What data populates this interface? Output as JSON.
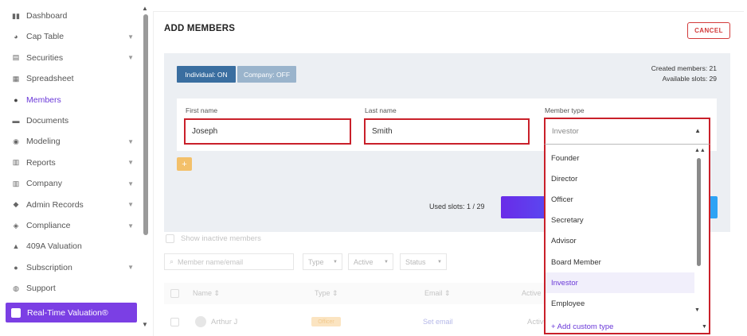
{
  "sidebar": {
    "items": [
      {
        "label": "Dashboard",
        "icon": "dashboard-icon",
        "chevron": false
      },
      {
        "label": "Cap Table",
        "icon": "pie-chart-icon",
        "chevron": true
      },
      {
        "label": "Securities",
        "icon": "clipboard-icon",
        "chevron": true
      },
      {
        "label": "Spreadsheet",
        "icon": "spreadsheet-icon",
        "chevron": false
      },
      {
        "label": "Members",
        "icon": "person-icon",
        "chevron": false,
        "active": true
      },
      {
        "label": "Documents",
        "icon": "folder-icon",
        "chevron": false
      },
      {
        "label": "Modeling",
        "icon": "lightbulb-icon",
        "chevron": true
      },
      {
        "label": "Reports",
        "icon": "report-icon",
        "chevron": true
      },
      {
        "label": "Company",
        "icon": "building-icon",
        "chevron": true
      },
      {
        "label": "Admin Records",
        "icon": "records-icon",
        "chevron": true
      },
      {
        "label": "Compliance",
        "icon": "shield-icon",
        "chevron": true
      },
      {
        "label": "409A Valuation",
        "icon": "chart-icon",
        "chevron": false
      },
      {
        "label": "Subscription",
        "icon": "dollar-icon",
        "chevron": true
      },
      {
        "label": "Support",
        "icon": "support-icon",
        "chevron": false
      }
    ],
    "cta_label": "Real-Time Valuation®"
  },
  "modal": {
    "title": "ADD MEMBERS",
    "cancel_label": "CANCEL",
    "toggle_individual": "Individual: ON",
    "toggle_company": "Company: OFF",
    "created_members": "Created members: 21",
    "available_slots": "Available slots: 29",
    "first_name_label": "First name",
    "first_name_value": "Joseph",
    "last_name_label": "Last name",
    "last_name_value": "Smith",
    "member_type_label": "Member type",
    "member_type_placeholder": "Investor",
    "add_label": "+",
    "used_slots": "Used slots: 1 / 29"
  },
  "dropdown": {
    "options": [
      "Founder",
      "Director",
      "Officer",
      "Secretary",
      "Advisor",
      "Board Member",
      "Investor",
      "Employee"
    ],
    "selected": "Investor",
    "add_custom": "+ Add custom type"
  },
  "background": {
    "show_inactive": "Show inactive members",
    "search_placeholder": "Member name/email",
    "filter_type": "Type",
    "filter_active": "Active",
    "filter_status": "Status",
    "col_name": "Name",
    "col_type": "Type",
    "col_email": "Email",
    "col_active": "Active",
    "row_name": "Arthur J",
    "row_badge": "Officer",
    "row_email": "Set email",
    "row_active": "Activ"
  },
  "colors": {
    "accent": "#7b3fe4",
    "danger": "#c9202a",
    "toggle_on": "#3a6ea0",
    "toggle_off": "#9ab4cc"
  }
}
